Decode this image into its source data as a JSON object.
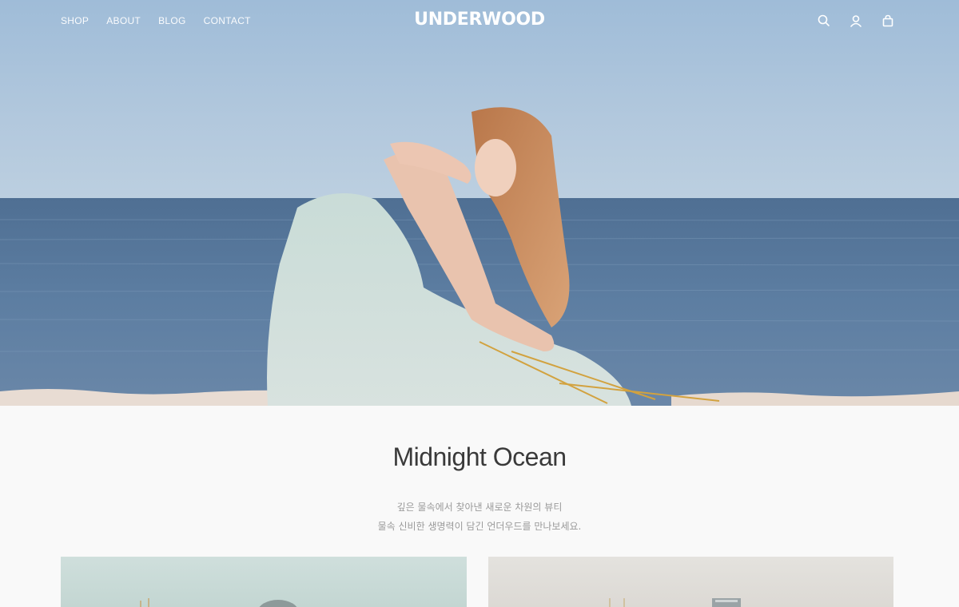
{
  "header": {
    "nav": [
      {
        "label": "SHOP"
      },
      {
        "label": "ABOUT"
      },
      {
        "label": "BLOG"
      },
      {
        "label": "CONTACT"
      }
    ],
    "logo": "UNDERWOOD",
    "icons": [
      "search-icon",
      "user-icon",
      "bag-icon"
    ]
  },
  "hero": {
    "sky_top": "#9fbedb",
    "sea": "#5a7ca0"
  },
  "section": {
    "title": "Midnight Ocean",
    "lines": [
      "깊은 물속에서 찾아낸 새로운 차원의 뷰티",
      "물속 신비한 생명력이 담긴 언더우드를 만나보세요."
    ]
  }
}
